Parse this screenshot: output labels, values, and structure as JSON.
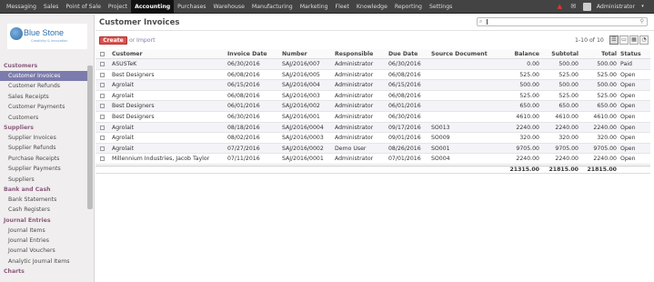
{
  "topbar": {
    "menu": [
      "Messaging",
      "Sales",
      "Point of Sale",
      "Project",
      "Accounting",
      "Purchases",
      "Warehouse",
      "Manufacturing",
      "Marketing",
      "Fleet",
      "Knowledge",
      "Reporting",
      "Settings"
    ],
    "active": "Accounting",
    "user": "Administrator"
  },
  "logo": {
    "name": "Blue Stone",
    "tagline": "Creativity & Innovation"
  },
  "sidebar": {
    "sections": [
      {
        "title": "Customers",
        "items": [
          "Customer Invoices",
          "Customer Refunds",
          "Sales Receipts",
          "Customer Payments",
          "Customers"
        ]
      },
      {
        "title": "Suppliers",
        "items": [
          "Supplier Invoices",
          "Supplier Refunds",
          "Purchase Receipts",
          "Supplier Payments",
          "Suppliers"
        ]
      },
      {
        "title": "Bank and Cash",
        "items": [
          "Bank Statements",
          "Cash Registers"
        ]
      },
      {
        "title": "Journal Entries",
        "items": [
          "Journal Items",
          "Journal Entries",
          "Journal Vouchers",
          "Analytic Journal Items"
        ]
      },
      {
        "title": "Charts",
        "items": []
      }
    ],
    "active_item": "Customer Invoices"
  },
  "main": {
    "title": "Customer Invoices",
    "search_value": "",
    "create_label": "Create",
    "or_label": "or",
    "import_label": "Import",
    "pager": "1-10 of 10"
  },
  "table": {
    "columns": [
      "Customer",
      "Invoice Date",
      "Number",
      "Responsible",
      "Due Date",
      "Source Document",
      "Balance",
      "Subtotal",
      "Total",
      "Status"
    ],
    "rows": [
      [
        "ASUSTeK",
        "06/30/2016",
        "SAJ/2016/007",
        "Administrator",
        "06/30/2016",
        "",
        "0.00",
        "500.00",
        "500.00",
        "Paid"
      ],
      [
        "Best Designers",
        "06/08/2016",
        "SAJ/2016/005",
        "Administrator",
        "06/08/2016",
        "",
        "525.00",
        "525.00",
        "525.00",
        "Open"
      ],
      [
        "Agrolait",
        "06/15/2016",
        "SAJ/2016/004",
        "Administrator",
        "06/15/2016",
        "",
        "500.00",
        "500.00",
        "500.00",
        "Open"
      ],
      [
        "Agrolait",
        "06/08/2016",
        "SAJ/2016/003",
        "Administrator",
        "06/08/2016",
        "",
        "525.00",
        "525.00",
        "525.00",
        "Open"
      ],
      [
        "Best Designers",
        "06/01/2016",
        "SAJ/2016/002",
        "Administrator",
        "06/01/2016",
        "",
        "650.00",
        "650.00",
        "650.00",
        "Open"
      ],
      [
        "Best Designers",
        "06/30/2016",
        "SAJ/2016/001",
        "Administrator",
        "06/30/2016",
        "",
        "4610.00",
        "4610.00",
        "4610.00",
        "Open"
      ],
      [
        "Agrolait",
        "08/18/2016",
        "SAJ/2016/0004",
        "Administrator",
        "09/17/2016",
        "SO013",
        "2240.00",
        "2240.00",
        "2240.00",
        "Open"
      ],
      [
        "Agrolait",
        "08/02/2016",
        "SAJ/2016/0003",
        "Administrator",
        "09/01/2016",
        "SO009",
        "320.00",
        "320.00",
        "320.00",
        "Open"
      ],
      [
        "Agrolait",
        "07/27/2016",
        "SAJ/2016/0002",
        "Demo User",
        "08/26/2016",
        "SO001",
        "9705.00",
        "9705.00",
        "9705.00",
        "Open"
      ],
      [
        "Millennium Industries, Jacob Taylor",
        "07/11/2016",
        "SAJ/2016/0001",
        "Administrator",
        "07/01/2016",
        "SO004",
        "2240.00",
        "2240.00",
        "2240.00",
        "Open"
      ]
    ],
    "totals": {
      "balance": "21315.00",
      "subtotal": "21815.00",
      "total": "21815.00"
    }
  },
  "colors": {
    "accent": "#7c7bad",
    "create": "#d9534f",
    "section": "#8a5a7e",
    "topbar": "#434343"
  }
}
